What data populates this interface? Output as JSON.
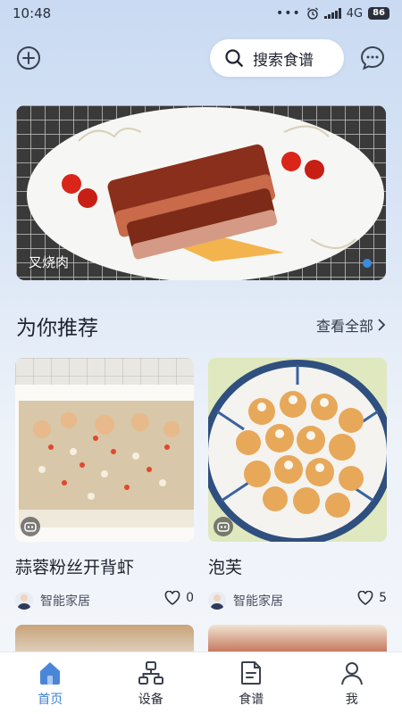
{
  "status_bar": {
    "time": "10:48",
    "dots": "•••",
    "network": "4G",
    "battery": "86"
  },
  "header": {
    "search_label": "搜索食谱"
  },
  "banner": {
    "caption": "叉烧肉"
  },
  "recommend": {
    "title": "为你推荐",
    "see_all": "查看全部"
  },
  "cards": [
    {
      "title": "蒜蓉粉丝开背虾",
      "author": "智能家居",
      "likes": "0"
    },
    {
      "title": "泡芙",
      "author": "智能家居",
      "likes": "5"
    }
  ],
  "nav": {
    "items": [
      {
        "label": "首页",
        "icon": "home-icon"
      },
      {
        "label": "设备",
        "icon": "devices-icon"
      },
      {
        "label": "食谱",
        "icon": "recipe-icon"
      },
      {
        "label": "我",
        "icon": "profile-icon"
      }
    ]
  },
  "colors": {
    "accent": "#3d7fd6",
    "dot": "#3d8bdc"
  }
}
